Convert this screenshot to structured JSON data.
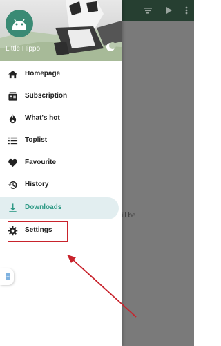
{
  "header": {
    "app_name": "Little Hippo",
    "logo_icon": "android-logo-icon",
    "theme_toggle_icon": "moon-icon"
  },
  "toolbar": {
    "icons": [
      "filter-icon",
      "play-icon",
      "more-vert-icon"
    ]
  },
  "background": {
    "partial_text": "ill be"
  },
  "nav": {
    "items": [
      {
        "label": "Homepage",
        "icon": "home-icon"
      },
      {
        "label": "Subscription",
        "icon": "subscription-icon"
      },
      {
        "label": "What's hot",
        "icon": "fire-icon"
      },
      {
        "label": "Toplist",
        "icon": "list-icon"
      },
      {
        "label": "Favourite",
        "icon": "heart-icon"
      },
      {
        "label": "History",
        "icon": "history-icon"
      },
      {
        "label": "Downloads",
        "icon": "download-icon",
        "active": true
      },
      {
        "label": "Settings",
        "icon": "gear-icon"
      }
    ]
  },
  "colors": {
    "accent": "#2f9a86",
    "toolbar": "#263f31",
    "active_bg": "#e2eef0",
    "annotation": "#c8232c"
  }
}
